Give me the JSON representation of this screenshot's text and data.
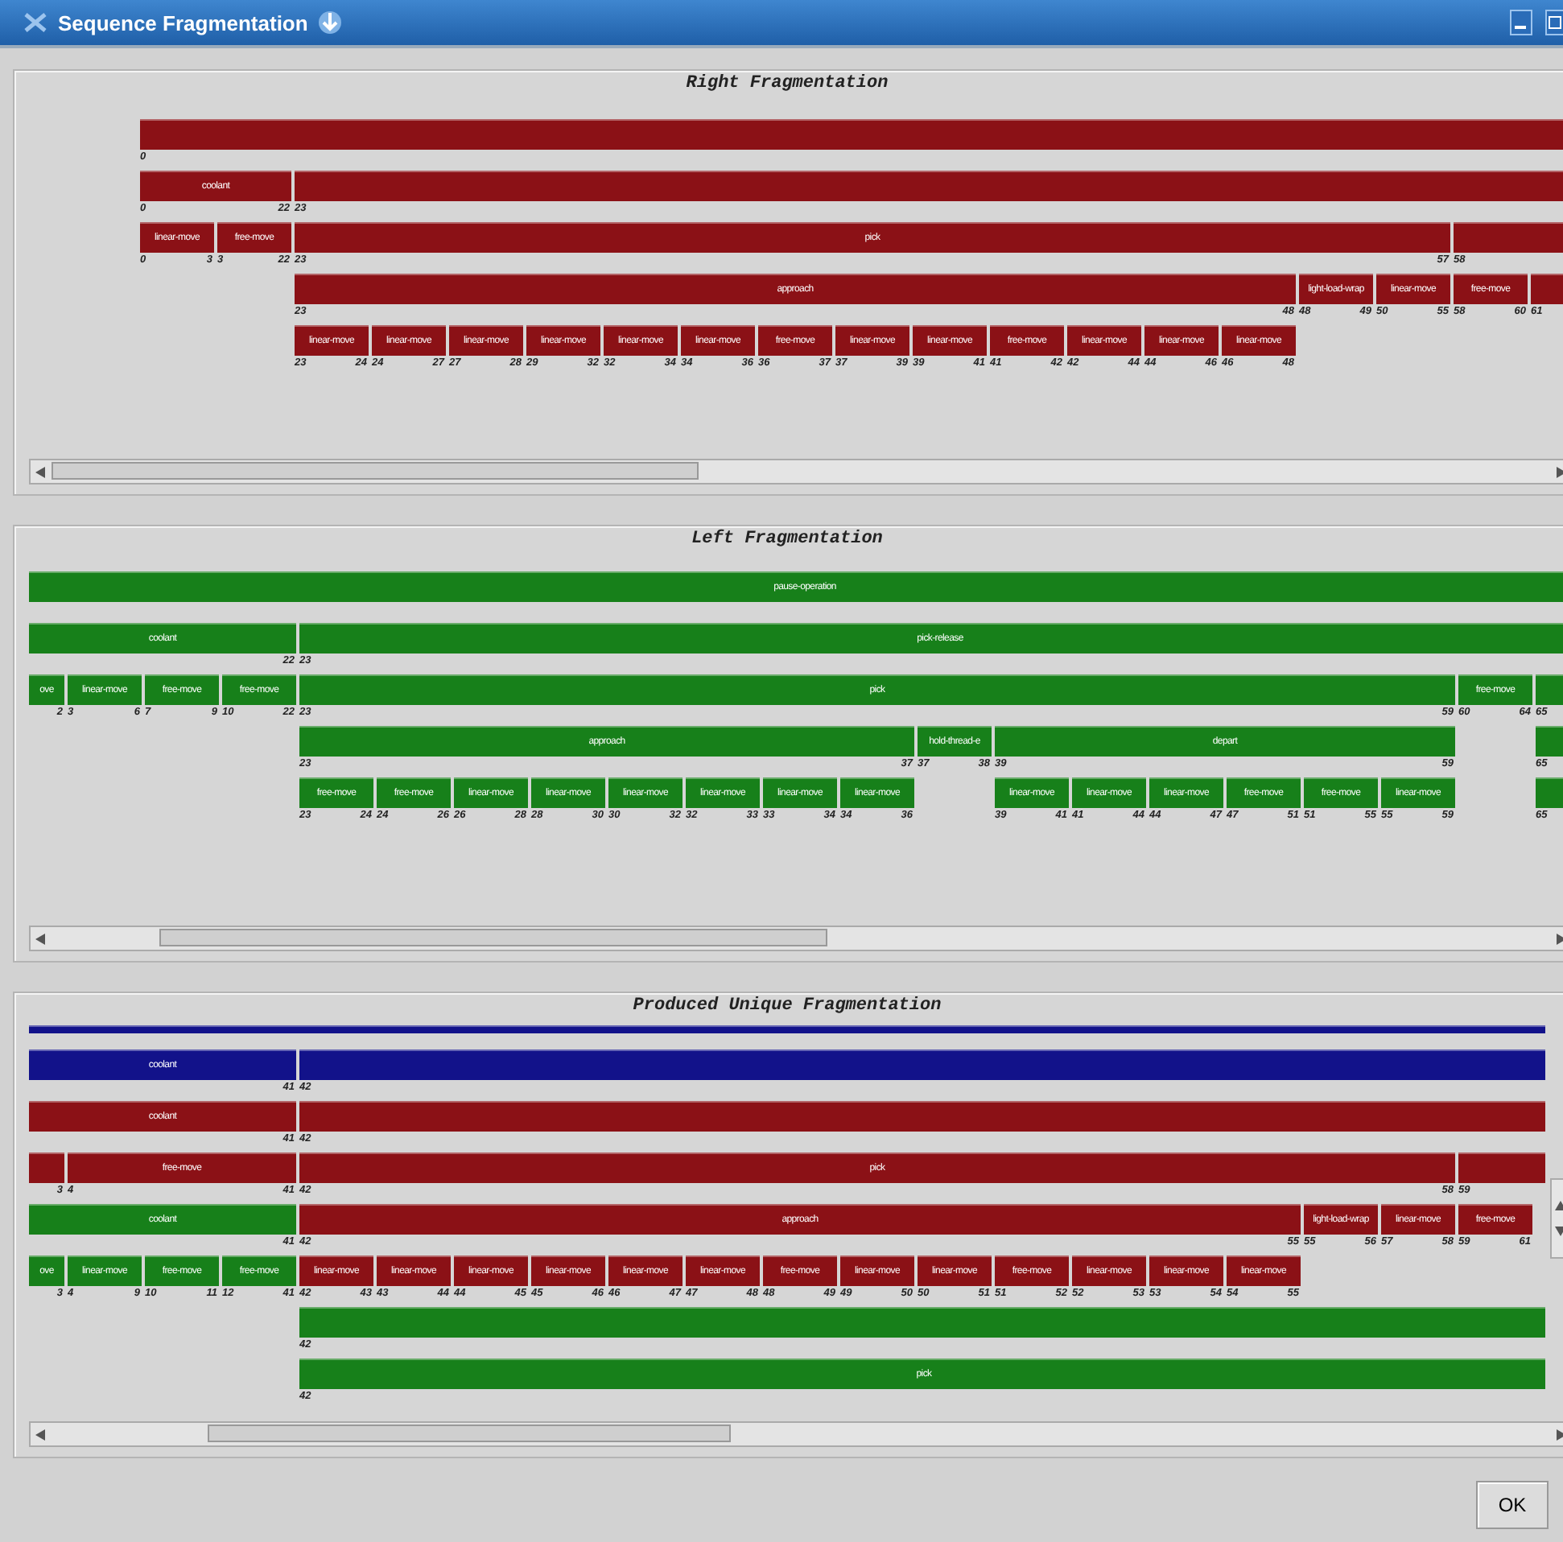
{
  "window": {
    "title": "Sequence Fragmentation"
  },
  "panels": [
    {
      "title": "Right Fragmentation",
      "vertical_scrollbar": false,
      "rows": [
        {
          "kind": "bar",
          "segments": [
            {
              "from": "0",
              "color": "#8b1116"
            }
          ]
        },
        {
          "kind": "bar",
          "segments": [
            {
              "label": "coolant",
              "from": "0",
              "to": "22",
              "color": "#8b1116"
            },
            {
              "from": "23",
              "color": "#8b1116"
            }
          ]
        },
        {
          "kind": "bar",
          "segments": [
            {
              "label": "linear-move",
              "from": "0",
              "to": "3",
              "color": "#8b1116"
            },
            {
              "label": "free-move",
              "from": "3",
              "to": "22",
              "color": "#8b1116"
            },
            {
              "label": "pick",
              "from": "23",
              "to": "57",
              "color": "#8b1116"
            },
            {
              "from": "58",
              "color": "#8b1116"
            }
          ]
        },
        {
          "kind": "bar",
          "segments": [
            {
              "label": "approach",
              "from": "23",
              "to": "48",
              "color": "#8b1116"
            },
            {
              "label": "light-load-wrap",
              "from": "48",
              "to": "49",
              "color": "#8b1116"
            },
            {
              "label": "linear-move",
              "from": "50",
              "to": "55",
              "color": "#8b1116"
            },
            {
              "label": "free-move",
              "from": "58",
              "to": "60",
              "color": "#8b1116"
            },
            {
              "from": "61",
              "color": "#8b1116"
            }
          ]
        },
        {
          "kind": "bar",
          "segments": [
            {
              "label": "linear-move",
              "from": "23",
              "to": "24",
              "color": "#8b1116"
            },
            {
              "label": "linear-move",
              "from": "24",
              "to": "27",
              "color": "#8b1116"
            },
            {
              "label": "linear-move",
              "from": "27",
              "to": "28",
              "color": "#8b1116"
            },
            {
              "label": "linear-move",
              "from": "29",
              "to": "32",
              "color": "#8b1116"
            },
            {
              "label": "linear-move",
              "from": "32",
              "to": "34",
              "color": "#8b1116"
            },
            {
              "label": "linear-move",
              "from": "34",
              "to": "36",
              "color": "#8b1116"
            },
            {
              "label": "free-move",
              "from": "36",
              "to": "37",
              "color": "#8b1116"
            },
            {
              "label": "linear-move",
              "from": "37",
              "to": "39",
              "color": "#8b1116"
            },
            {
              "label": "linear-move",
              "from": "39",
              "to": "41",
              "color": "#8b1116"
            },
            {
              "label": "free-move",
              "from": "41",
              "to": "42",
              "color": "#8b1116"
            },
            {
              "label": "linear-move",
              "from": "42",
              "to": "44",
              "color": "#8b1116"
            },
            {
              "label": "linear-move",
              "from": "44",
              "to": "46",
              "color": "#8b1116"
            },
            {
              "label": "linear-move",
              "from": "46",
              "to": "48",
              "color": "#8b1116"
            }
          ]
        }
      ]
    },
    {
      "title": "Left Fragmentation",
      "vertical_scrollbar": false,
      "rows": [
        {
          "kind": "bar",
          "segments": [
            {
              "label": "pause-operation",
              "color": "#17801a"
            }
          ]
        },
        {
          "kind": "bar",
          "segments": [
            {
              "label": "coolant",
              "to": "22",
              "color": "#17801a"
            },
            {
              "label": "pick-release",
              "from": "23",
              "color": "#17801a"
            }
          ]
        },
        {
          "kind": "bar",
          "segments": [
            {
              "label": "ove",
              "to": "2",
              "color": "#17801a"
            },
            {
              "label": "linear-move",
              "from": "3",
              "to": "6",
              "color": "#17801a"
            },
            {
              "label": "free-move",
              "from": "7",
              "to": "9",
              "color": "#17801a"
            },
            {
              "label": "free-move",
              "from": "10",
              "to": "22",
              "color": "#17801a"
            },
            {
              "label": "pick",
              "from": "23",
              "to": "59",
              "color": "#17801a"
            },
            {
              "label": "free-move",
              "from": "60",
              "to": "64",
              "color": "#17801a"
            },
            {
              "from": "65",
              "color": "#17801a"
            }
          ]
        },
        {
          "kind": "bar",
          "segments": [
            {
              "label": "approach",
              "from": "23",
              "to": "37",
              "color": "#17801a"
            },
            {
              "label": "hold-thread-e",
              "from": "37",
              "to": "38",
              "color": "#17801a"
            },
            {
              "label": "depart",
              "from": "39",
              "to": "59",
              "color": "#17801a"
            },
            {
              "from": "65",
              "color": "#17801a"
            }
          ]
        },
        {
          "kind": "bar",
          "segments": [
            {
              "label": "free-move",
              "from": "23",
              "to": "24",
              "color": "#17801a"
            },
            {
              "label": "free-move",
              "from": "24",
              "to": "26",
              "color": "#17801a"
            },
            {
              "label": "linear-move",
              "from": "26",
              "to": "28",
              "color": "#17801a"
            },
            {
              "label": "linear-move",
              "from": "28",
              "to": "30",
              "color": "#17801a"
            },
            {
              "label": "linear-move",
              "from": "30",
              "to": "32",
              "color": "#17801a"
            },
            {
              "label": "linear-move",
              "from": "32",
              "to": "33",
              "color": "#17801a"
            },
            {
              "label": "linear-move",
              "from": "33",
              "to": "34",
              "color": "#17801a"
            },
            {
              "label": "linear-move",
              "from": "34",
              "to": "36",
              "color": "#17801a"
            },
            {
              "label": "linear-move",
              "from": "39",
              "to": "41",
              "color": "#17801a"
            },
            {
              "label": "linear-move",
              "from": "41",
              "to": "44",
              "color": "#17801a"
            },
            {
              "label": "linear-move",
              "from": "44",
              "to": "47",
              "color": "#17801a"
            },
            {
              "label": "free-move",
              "from": "47",
              "to": "51",
              "color": "#17801a"
            },
            {
              "label": "free-move",
              "from": "51",
              "to": "55",
              "color": "#17801a"
            },
            {
              "label": "linear-move",
              "from": "55",
              "to": "59",
              "color": "#17801a"
            },
            {
              "from": "65",
              "color": "#17801a"
            }
          ]
        }
      ]
    },
    {
      "title": "Produced Unique Fragmentation",
      "vertical_scrollbar": true,
      "rows": [
        {
          "kind": "line",
          "segments": [
            {
              "color": "#12128a"
            }
          ]
        },
        {
          "kind": "bar",
          "segments": [
            {
              "label": "coolant",
              "to": "41",
              "color": "#12128a"
            },
            {
              "from": "42",
              "color": "#12128a"
            }
          ]
        },
        {
          "kind": "bar",
          "segments": [
            {
              "label": "coolant",
              "to": "41",
              "color": "#8b1116"
            },
            {
              "from": "42",
              "color": "#8b1116"
            }
          ]
        },
        {
          "kind": "bar",
          "segments": [
            {
              "to": "3",
              "color": "#8b1116"
            },
            {
              "label": "free-move",
              "from": "4",
              "to": "41",
              "color": "#8b1116"
            },
            {
              "label": "pick",
              "from": "42",
              "to": "58",
              "color": "#8b1116"
            },
            {
              "from": "59",
              "color": "#8b1116"
            }
          ]
        },
        {
          "kind": "bar",
          "segments": [
            {
              "label": "coolant",
              "to": "41",
              "color": "#17801a"
            },
            {
              "label": "approach",
              "from": "42",
              "to": "55",
              "color": "#8b1116"
            },
            {
              "label": "light-load-wrap",
              "from": "55",
              "to": "56",
              "color": "#8b1116"
            },
            {
              "label": "linear-move",
              "from": "57",
              "to": "58",
              "color": "#8b1116"
            },
            {
              "label": "free-move",
              "from": "59",
              "to": "61",
              "color": "#8b1116"
            }
          ]
        },
        {
          "kind": "bar",
          "segments": [
            {
              "label": "ove",
              "to": "3",
              "color": "#17801a"
            },
            {
              "label": "linear-move",
              "from": "4",
              "to": "9",
              "color": "#17801a"
            },
            {
              "label": "free-move",
              "from": "10",
              "to": "11",
              "color": "#17801a"
            },
            {
              "label": "free-move",
              "from": "12",
              "to": "41",
              "color": "#17801a"
            },
            {
              "label": "linear-move",
              "from": "42",
              "to": "43",
              "color": "#8b1116"
            },
            {
              "label": "linear-move",
              "from": "43",
              "to": "44",
              "color": "#8b1116"
            },
            {
              "label": "linear-move",
              "from": "44",
              "to": "45",
              "color": "#8b1116"
            },
            {
              "label": "linear-move",
              "from": "45",
              "to": "46",
              "color": "#8b1116"
            },
            {
              "label": "linear-move",
              "from": "46",
              "to": "47",
              "color": "#8b1116"
            },
            {
              "label": "linear-move",
              "from": "47",
              "to": "48",
              "color": "#8b1116"
            },
            {
              "label": "free-move",
              "from": "48",
              "to": "49",
              "color": "#8b1116"
            },
            {
              "label": "linear-move",
              "from": "49",
              "to": "50",
              "color": "#8b1116"
            },
            {
              "label": "linear-move",
              "from": "50",
              "to": "51",
              "color": "#8b1116"
            },
            {
              "label": "free-move",
              "from": "51",
              "to": "52",
              "color": "#8b1116"
            },
            {
              "label": "linear-move",
              "from": "52",
              "to": "53",
              "color": "#8b1116"
            },
            {
              "label": "linear-move",
              "from": "53",
              "to": "54",
              "color": "#8b1116"
            },
            {
              "label": "linear-move",
              "from": "54",
              "to": "55",
              "color": "#8b1116"
            }
          ]
        },
        {
          "kind": "bar",
          "segments": [
            {
              "from": "42",
              "color": "#17801a"
            }
          ]
        },
        {
          "kind": "bar",
          "segments": [
            {
              "label": "pick",
              "from": "42",
              "color": "#17801a"
            }
          ]
        }
      ]
    }
  ],
  "ok_button": "OK"
}
